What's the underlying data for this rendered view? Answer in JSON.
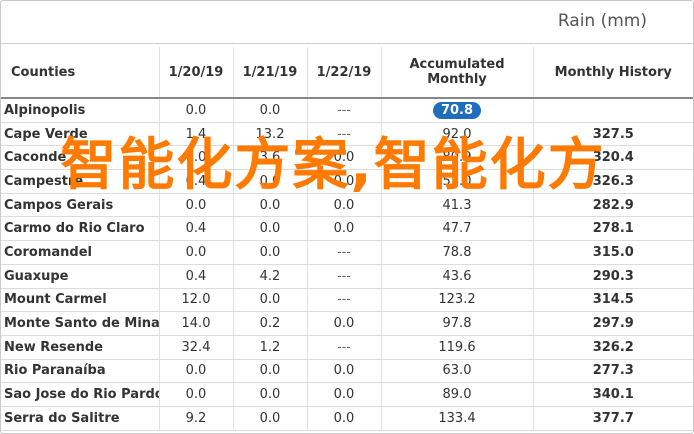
{
  "header": {
    "title": "Rain (mm)"
  },
  "table": {
    "columns": [
      "Counties",
      "1/20/19",
      "1/21/19",
      "1/22/19",
      "Accumulated Monthly",
      "Monthly History"
    ],
    "rows": [
      [
        "Alpinopolis",
        "0.0",
        "0.0",
        "---",
        "70.8",
        ""
      ],
      [
        "Cape Verde",
        "1.4",
        "13.2",
        "---",
        "92.0",
        "327.5"
      ],
      [
        "Caconde",
        "0.0",
        "3.6",
        "0.0",
        "80.9",
        "320.4"
      ],
      [
        "Campestre",
        "0.4",
        "0.0",
        "0.0",
        "52.0",
        "326.3"
      ],
      [
        "Campos Gerais",
        "0.0",
        "0.0",
        "0.0",
        "41.3",
        "282.9"
      ],
      [
        "Carmo do Rio Claro",
        "0.4",
        "0.0",
        "0.0",
        "47.7",
        "278.1"
      ],
      [
        "Coromandel",
        "0.0",
        "0.0",
        "---",
        "78.8",
        "315.0"
      ],
      [
        "Guaxupe",
        "0.4",
        "4.2",
        "---",
        "43.6",
        "290.3"
      ],
      [
        "Mount Carmel",
        "12.0",
        "0.0",
        "---",
        "123.2",
        "314.5"
      ],
      [
        "Monte Santo de Minas",
        "14.0",
        "0.2",
        "0.0",
        "97.8",
        "297.9"
      ],
      [
        "New Resende",
        "32.4",
        "1.2",
        "---",
        "119.6",
        "326.2"
      ],
      [
        "Rio Paranaíba",
        "0.0",
        "0.0",
        "0.0",
        "63.0",
        "277.3"
      ],
      [
        "Sao Jose do Rio Pardo",
        "0.0",
        "0.0",
        "0.0",
        "89.0",
        "340.1"
      ],
      [
        "Serra do Salitre",
        "9.2",
        "0.0",
        "0.0",
        "133.4",
        "377.7"
      ]
    ]
  },
  "watermark": {
    "text": "智能化方案,智能化方"
  },
  "colors": {
    "pill": "#1f6dbb",
    "watermark": "#ff7a00"
  }
}
